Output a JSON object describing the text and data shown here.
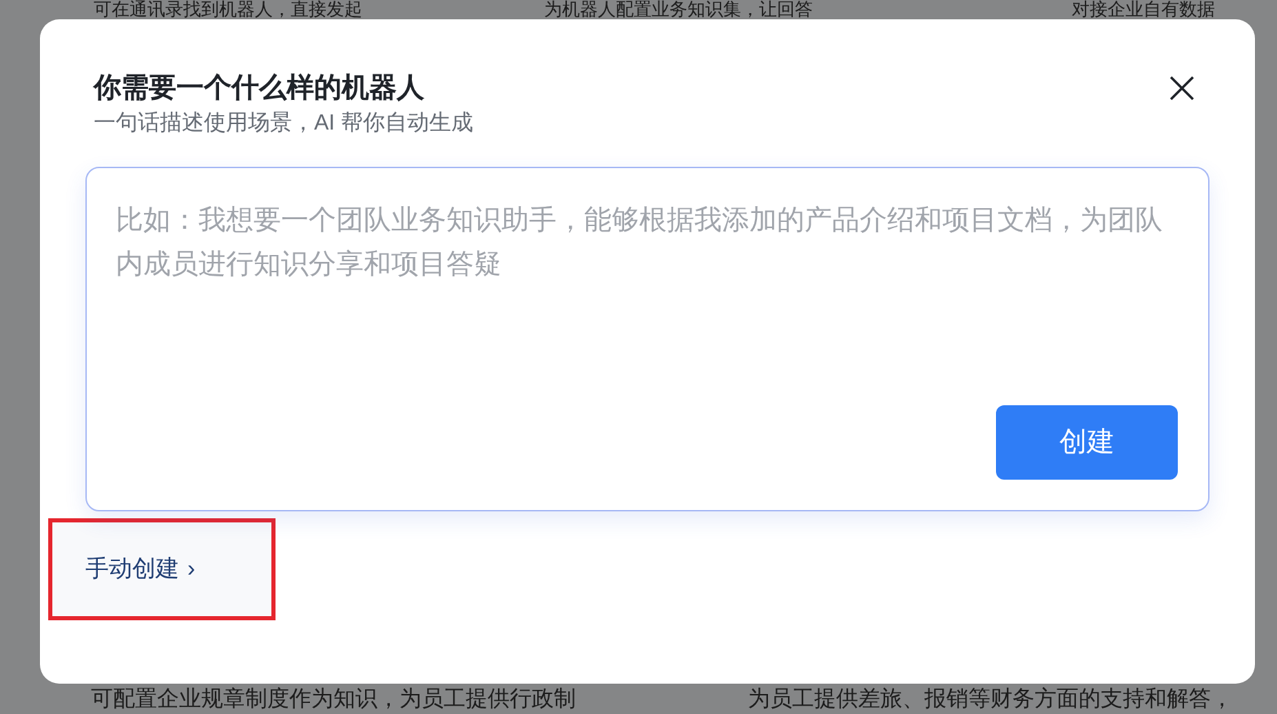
{
  "background_cards": {
    "top": [
      "可在通讯录找到机器人，直接发起",
      "为机器人配置业务知识集，让回答",
      "对接企业自有数据"
    ],
    "bottom": [
      "可配置企业规章制度作为知识，为员工提供行政制",
      "为员工提供差旅、报销等财务方面的支持和解答，"
    ]
  },
  "dialog": {
    "title": "你需要一个什么样的机器人",
    "subtitle": "一句话描述使用场景，AI 帮你自动生成",
    "prompt": {
      "placeholder": "比如：我想要一个团队业务知识助手，能够根据我添加的产品介绍和项目文档，为团队内成员进行知识分享和项目答疑"
    },
    "create_button": "创建",
    "manual_link": {
      "label": "手动创建",
      "icon": "›",
      "highlighted": true
    }
  }
}
